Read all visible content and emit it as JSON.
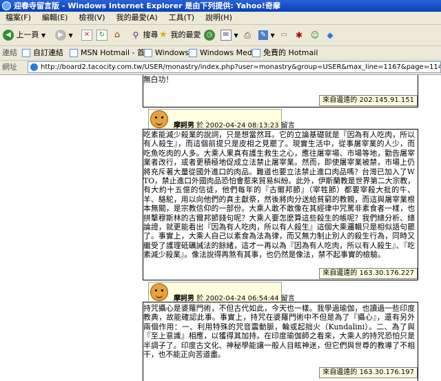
{
  "window": {
    "title": "迎春寺留言版 - Windows Internet Explorer 是由下列提供: Yahoo!奇摩"
  },
  "menu": [
    "檔案(F)",
    "編輯(E)",
    "檢視(V)",
    "我的最愛(A)",
    "工具(T)",
    "說明(H)"
  ],
  "toolbar": {
    "back_label": "上一頁",
    "search_label": "搜尋",
    "favorites_label": "我的最愛"
  },
  "links_bar": {
    "label": "連結",
    "items": [
      "自訂連結",
      "MSN Hotmail - 首頁",
      "Windows",
      "Windows Media",
      "免費的 Hotmail"
    ]
  },
  "address_bar": {
    "label": "網址",
    "url": "http://board2.tacocity.com.tw/USER/monastry/index.php?user=monastry&group=USER&max_line=1167&page=114"
  },
  "messages": [
    {
      "tail_text": "無白功！",
      "ip": "來自邊遠的 202.145.91.151"
    },
    {
      "author": "摩訶男",
      "meta": "於 2002-04-24 08:13:23 留言",
      "body": "吃素能減少殺業的說詞，只是想當然耳。它的立論基礎就是『因為有人吃肉，所以有人殺生』，而這個前提只是皮相之見罷了。現實生活中，從事屠宰業的人少，而吃魚吃肉的人多。大乘人果真有護生救生之心，應往屠宰場、市場等地，勸告屠宰業者改行，或者更積極地促成立法禁止屠宰業。然而，即使屠宰業被禁，市場上仍將充斥著大量從國外進口的肉品。難道也要立法禁止進口肉品嗎？台灣已加入了WTO，禁止進口外國肉品恐怕會惹來貿易糾紛。此外，伊斯蘭教是世界第二大宗教，有大約十五億的信徒，他們每年的『古爾邦節』（宰牲節）都要宰殺大批的牛、羊、駱駝，用以向他們的真主獻祭，然後將肉分送給貧窮的教親，而這與屠宰業根本無關，是宗教信仰的一部份。大乘人敢不敢像在其經律中咒罵非素食者一樣，也拼擊穆斯林的古爾邦節錢句呢？大乘人要怎麼算這些殺生的帳呢？我們總分析、總論證，就更能看出『因為有人吃肉，所以有人殺生』這個大乘邏輯只是相似語句罷了。事實上，大乘人自己以素食為法為律，而又無力制止別人的殺生行為，同時又繼受了護理砥礪誡法的餘緒，這才一再以為『因為有人吃肉，所以有人殺生』、『吃素減少殺業』。像法說得再煞有其事，也仍然是像法，禁不起事實的檢驗。",
      "ip": "來自邊遠的 163.30.176.227"
    },
    {
      "author": "摩訶男",
      "meta": "於 2002-04-24 06:54:44 留言",
      "body": "持咒攝心是婆羅門術，不但古代如此，今天也一樣。我學過瑜伽，也讀過一些印度教典，故能確認此事。事實上，持咒在婆羅門術中不但是為了『攝心』，還有另外兩個作用：一、利用特殊的咒音震動脈，輪或起拙火（Kundalini）。二、為了與『至上意識』相應，以獲得其加持。在印度瑜伽師之看來，大乘人的持咒恐怕只是半調子了。印度古文化、神秘學能讓一般人目眩神迷，但它們與世尊的教導了不相干，也不能正向苦道盡。",
      "ip": "來自邊遠的 163.30.176.197"
    }
  ]
}
